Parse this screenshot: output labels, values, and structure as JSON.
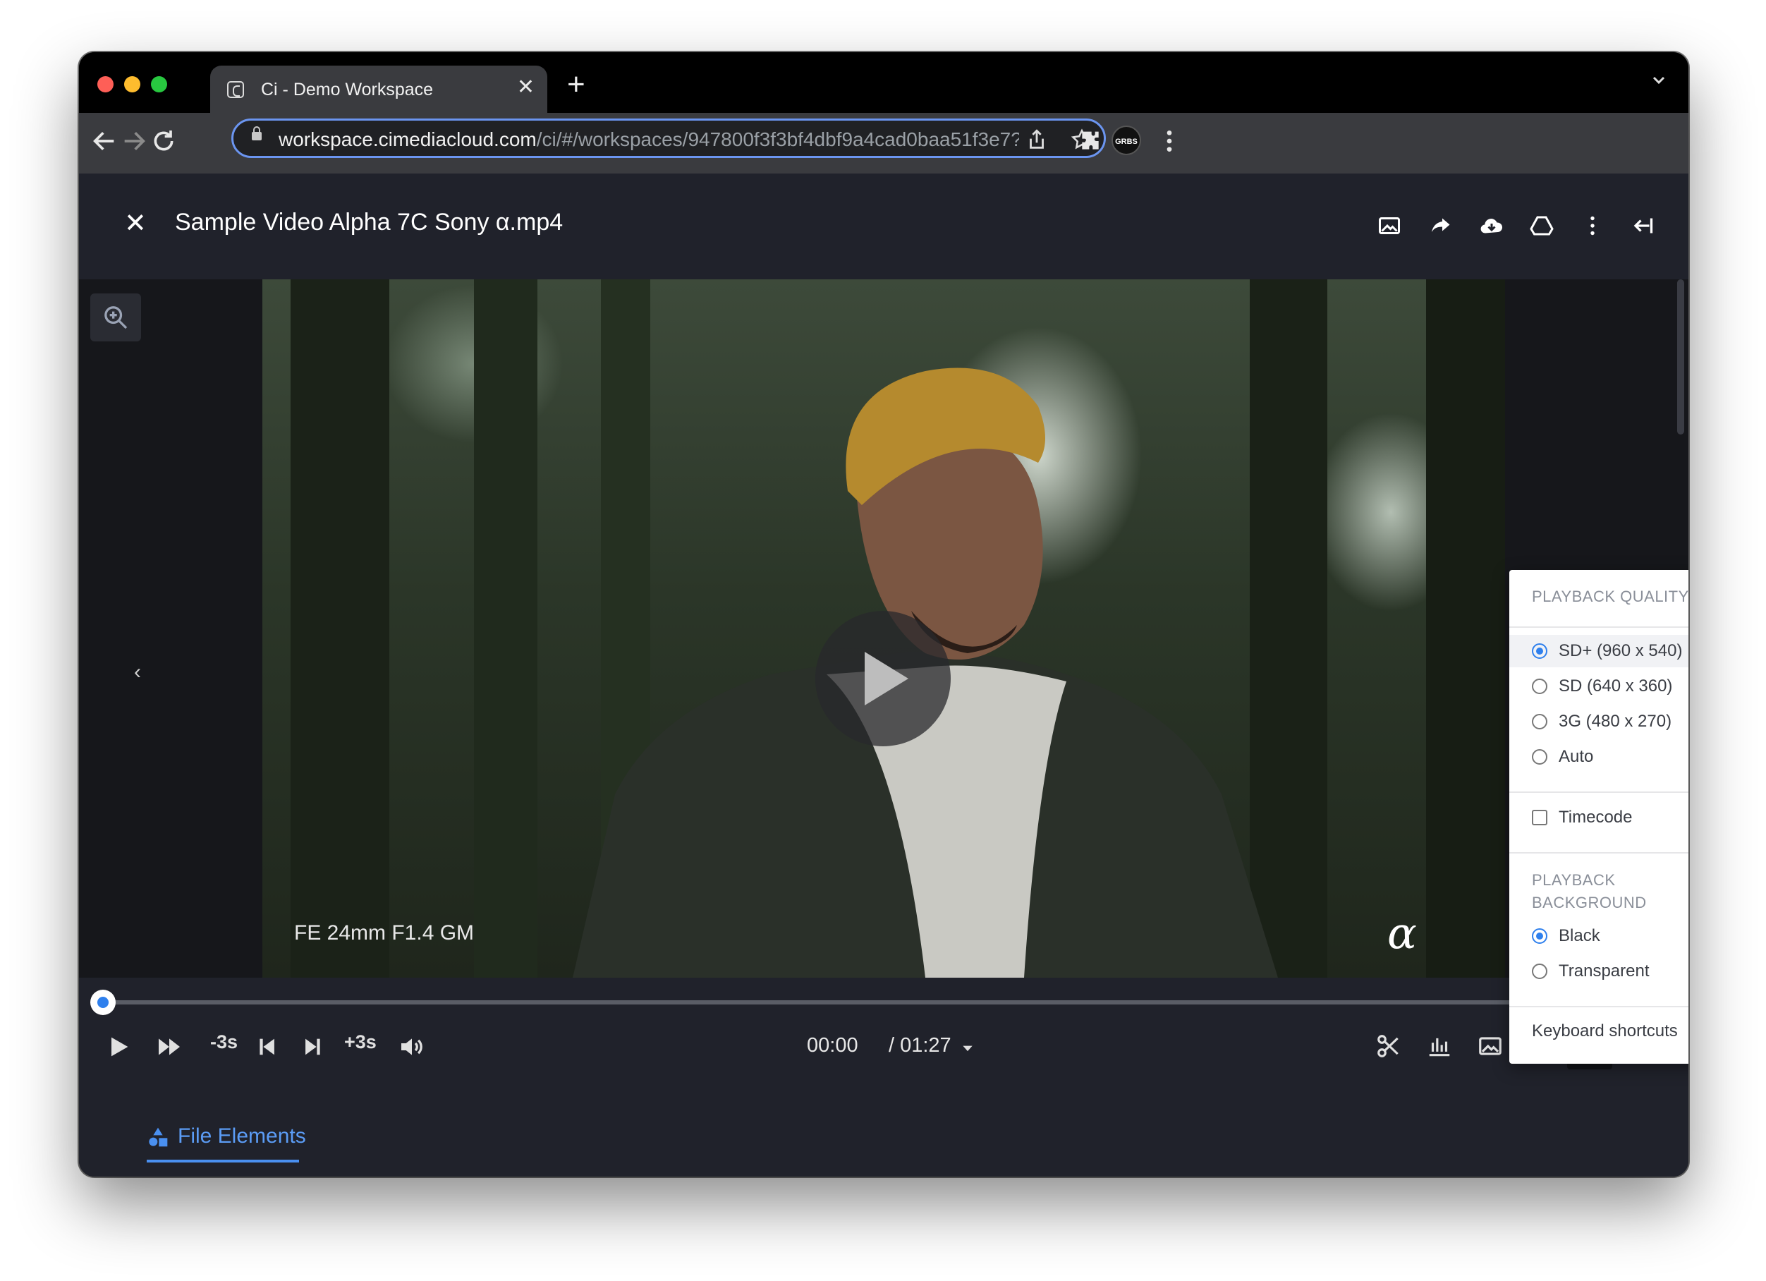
{
  "browser": {
    "tab_title": "Ci - Demo Workspace",
    "url_host": "workspace.cimediacloud.com",
    "url_path": "/ci/#/workspaces/947800f3f3bf4dbf9a4cad0baa51f3e7?page=1&orderBy=CreatedOn&order...",
    "profile_label": "GRBS"
  },
  "header": {
    "file_title": "Sample Video Alpha 7C Sony α.mp4"
  },
  "video": {
    "lens_caption": "FE 24mm F1.4 GM",
    "brand_mark": "α"
  },
  "player": {
    "back_label": "-3s",
    "forward_label": "+3s",
    "current_time": "00:00",
    "duration": "/ 01:27",
    "progress": 0
  },
  "settings_menu": {
    "quality_heading": "PLAYBACK QUALITY",
    "quality_options": [
      {
        "label": "SD+ (960 x 540)",
        "selected": true
      },
      {
        "label": "SD (640 x 360)",
        "selected": false
      },
      {
        "label": "3G (480 x 270)",
        "selected": false
      },
      {
        "label": "Auto",
        "selected": false
      }
    ],
    "timecode_label": "Timecode",
    "timecode_checked": false,
    "background_heading_line1": "PLAYBACK",
    "background_heading_line2": "BACKGROUND",
    "background_options": [
      {
        "label": "Black",
        "selected": true
      },
      {
        "label": "Transparent",
        "selected": false
      }
    ],
    "keyboard_shortcuts_label": "Keyboard shortcuts"
  },
  "bottom_tabs": {
    "file_elements_label": "File Elements"
  },
  "colors": {
    "accent": "#2f80ed",
    "app_bg": "#20222b",
    "tab_active": "#5b9cf5"
  }
}
